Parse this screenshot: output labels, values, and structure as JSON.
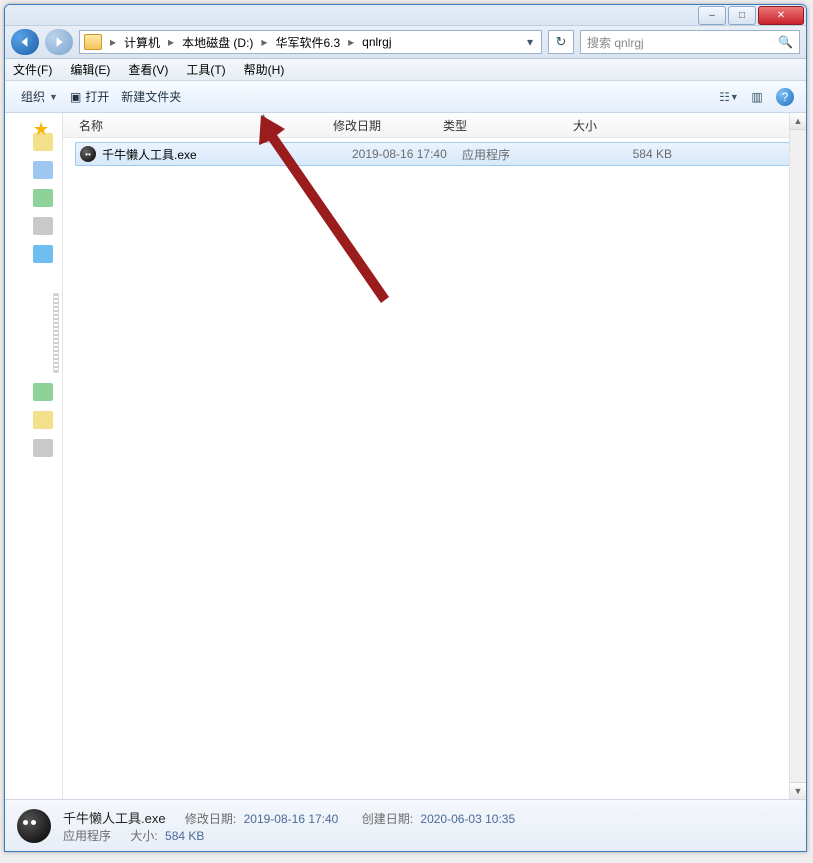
{
  "window_controls": {
    "min": "–",
    "max": "□",
    "close": "✕"
  },
  "breadcrumb": {
    "items": [
      "计算机",
      "本地磁盘 (D:)",
      "华军软件6.3",
      "qnlrgj"
    ]
  },
  "search": {
    "placeholder": "搜索 qnlrgj"
  },
  "menubar": {
    "file": "文件(F)",
    "edit": "编辑(E)",
    "view": "查看(V)",
    "tools": "工具(T)",
    "help": "帮助(H)"
  },
  "toolbar": {
    "organize": "组织",
    "open": "打开",
    "newfolder": "新建文件夹"
  },
  "columns": {
    "name": "名称",
    "modified": "修改日期",
    "type": "类型",
    "size": "大小"
  },
  "files": [
    {
      "name": "千牛懒人工具.exe",
      "modified": "2019-08-16 17:40",
      "type": "应用程序",
      "size": "584 KB"
    }
  ],
  "details": {
    "name": "千牛懒人工具.exe",
    "type": "应用程序",
    "mod_label": "修改日期:",
    "mod_value": "2019-08-16 17:40",
    "created_label": "创建日期:",
    "created_value": "2020-06-03 10:35",
    "size_label": "大小:",
    "size_value": "584 KB"
  }
}
